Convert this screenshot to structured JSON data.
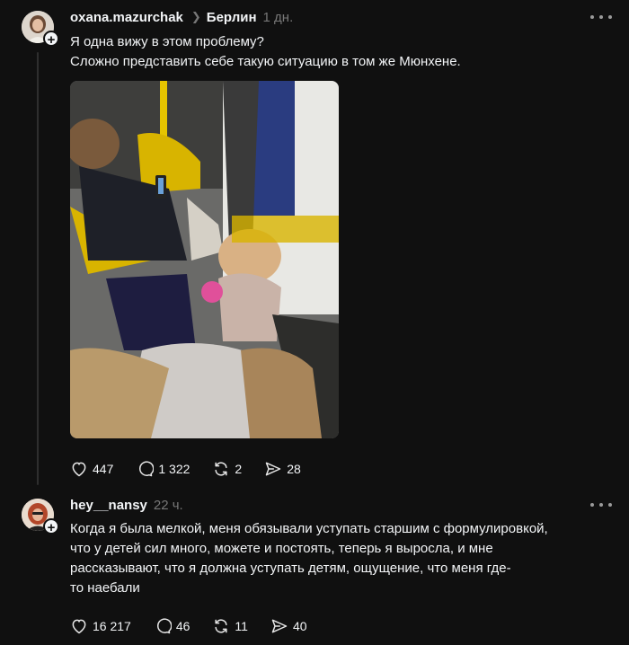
{
  "post1": {
    "username": "oxana.mazurchak",
    "topic": "Берлин",
    "time": "1 дн.",
    "lines": [
      "Я одна вижу в этом проблему?",
      "Сложно представить себе такую ситуацию в том же Мюнхене."
    ],
    "stats": {
      "likes": "447",
      "comments": "1 322",
      "reposts": "2",
      "shares": "28"
    }
  },
  "post2": {
    "username": "hey__nansy",
    "time": "22 ч.",
    "lines": [
      "Когда я была мелкой, меня обязывали уступать старшим с формулировкой,",
      "что у детей сил много, можете и постоять, теперь я выросла, и мне",
      "рассказывают, что я должна уступать детям, ощущение, что меня где-",
      "то наебали"
    ],
    "stats": {
      "likes": "16 217",
      "comments": "46",
      "reposts": "11",
      "shares": "40"
    }
  },
  "icons": {
    "like": "heart-icon",
    "comment": "comment-bubble-icon",
    "repost": "repost-arrows-icon",
    "share": "paper-plane-icon",
    "more": "more-horizontal-icon",
    "follow": "plus-icon",
    "chevron": "chevron-right-icon"
  }
}
